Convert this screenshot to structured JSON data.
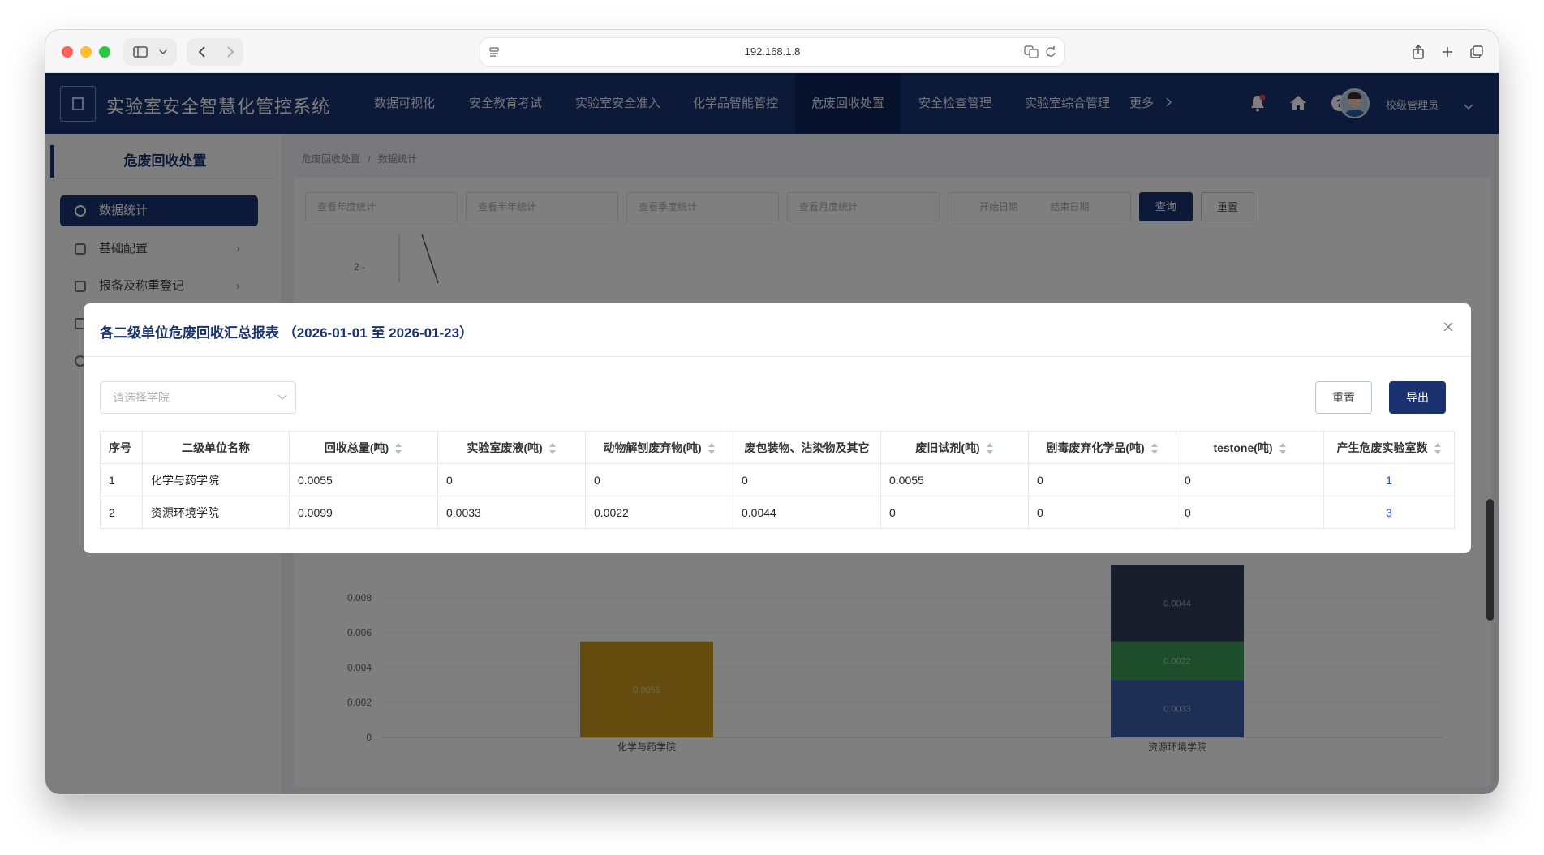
{
  "browser": {
    "url": "192.168.1.8"
  },
  "app": {
    "title": "实验室安全智慧化管控系统",
    "nav": [
      {
        "label": "数据可视化"
      },
      {
        "label": "安全教育考试"
      },
      {
        "label": "实验室安全准入"
      },
      {
        "label": "化学品智能管控"
      },
      {
        "label": "危废回收处置",
        "active": true
      },
      {
        "label": "安全检查管理"
      },
      {
        "label": "实验室综合管理"
      },
      {
        "label": "更多"
      }
    ],
    "user_name": "校级管理员"
  },
  "sidebar": {
    "header": "危废回收处置",
    "items": [
      {
        "label": "数据统计",
        "active": true
      },
      {
        "label": "基础配置"
      },
      {
        "label": "报备及称重登记"
      }
    ]
  },
  "breadcrumb": {
    "parent": "危废回收处置",
    "separator": "/",
    "current": "数据统计"
  },
  "filters": {
    "year_placeholder": "查看年度统计",
    "halfyear_placeholder": "查看半年统计",
    "quarter_placeholder": "查看季度统计",
    "month_placeholder": "查看月度统计",
    "start_placeholder": "开始日期",
    "end_placeholder": "结束日期",
    "query_label": "查询",
    "reset_label": "重置"
  },
  "chart_data": {
    "type": "bar",
    "stacked": true,
    "categories": [
      "化学与药学院",
      "资源环境学院"
    ],
    "series": [
      {
        "values": [
          0,
          0.0033
        ],
        "color": "#3b5fa8"
      },
      {
        "values": [
          0,
          0.0022
        ],
        "color": "#3a9a57"
      },
      {
        "values": [
          0,
          0.0044
        ],
        "color": "#2e3a55"
      },
      {
        "values": [
          0.0055,
          0
        ],
        "color": "#c9981d"
      }
    ],
    "bar_labels": [
      {
        "category": "化学与药学院",
        "text": "0.0055"
      },
      {
        "category": "资源环境学院",
        "text": "0.0044"
      },
      {
        "category": "资源环境学院",
        "text": "0.0022"
      },
      {
        "category": "资源环境学院",
        "text": "0.0033"
      }
    ],
    "y_ticks": [
      "0",
      "0.002",
      "0.004",
      "0.006",
      "0.008"
    ],
    "ylim": [
      0,
      0.01
    ],
    "upper_tick": "2"
  },
  "modal": {
    "title": "各二级单位危废回收汇总报表 （2026-01-01 至 2026-01-23）",
    "close_icon": "close-icon",
    "college_placeholder": "请选择学院",
    "reset_label": "重置",
    "export_label": "导出",
    "columns": [
      {
        "label": "序号",
        "sortable": false
      },
      {
        "label": "二级单位名称",
        "sortable": false
      },
      {
        "label": "回收总量(吨)",
        "sortable": true
      },
      {
        "label": "实验室废液(吨)",
        "sortable": true
      },
      {
        "label": "动物解刨废弃物(吨)",
        "sortable": true
      },
      {
        "label": "废包装物、沾染物及其它",
        "sortable": false
      },
      {
        "label": "废旧试剂(吨)",
        "sortable": true
      },
      {
        "label": "剧毒废弃化学品(吨)",
        "sortable": true
      },
      {
        "label": "testone(吨)",
        "sortable": true
      },
      {
        "label": "产生危废实验室数",
        "sortable": true
      }
    ],
    "rows": [
      [
        "1",
        "化学与药学院",
        "0.0055",
        "0",
        "0",
        "0",
        "0.0055",
        "0",
        "0",
        "1"
      ],
      [
        "2",
        "资源环境学院",
        "0.0099",
        "0.0033",
        "0.0022",
        "0.0044",
        "0",
        "0",
        "0",
        "3"
      ]
    ]
  }
}
